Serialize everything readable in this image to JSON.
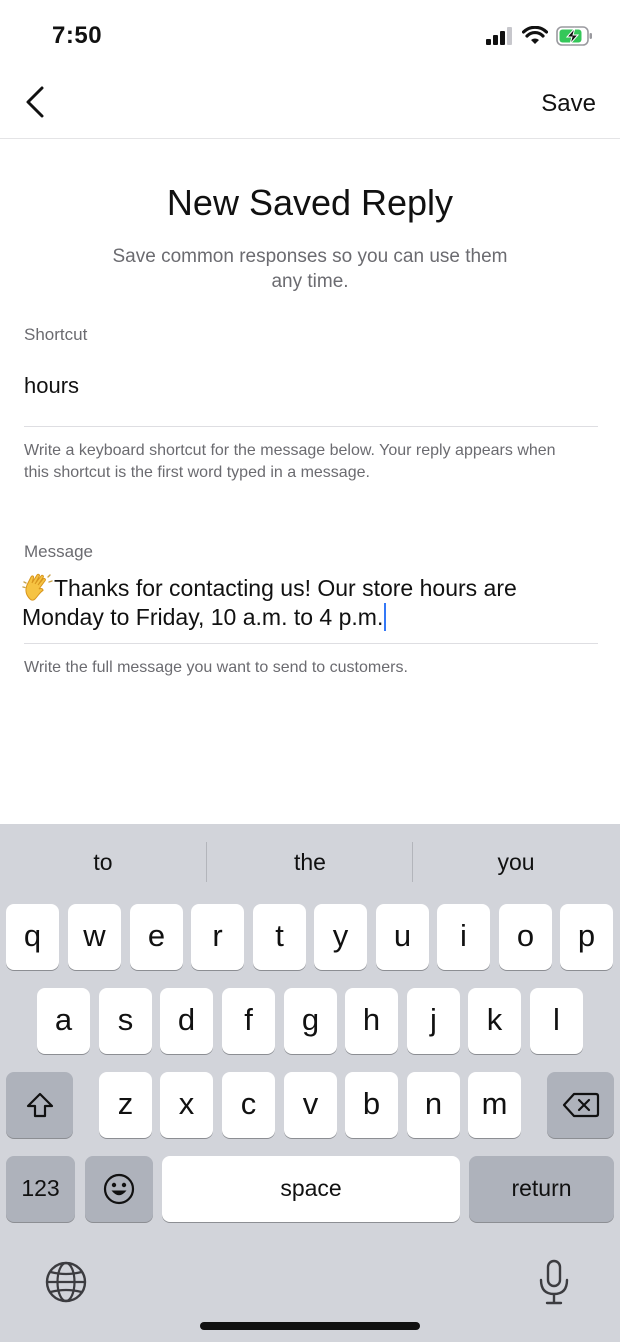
{
  "status_bar": {
    "time": "7:50",
    "icons": [
      "cellular-signal-icon",
      "wifi-icon",
      "battery-charging-icon"
    ]
  },
  "nav": {
    "back_icon": "chevron-left-icon",
    "save_label": "Save"
  },
  "form": {
    "title": "New Saved Reply",
    "subtitle": "Save common responses so you can use them any time.",
    "shortcut": {
      "label": "Shortcut",
      "value": "hours",
      "help": "Write a keyboard shortcut for the message below. Your reply appears when this shortcut is the first word typed in a message."
    },
    "message": {
      "label": "Message",
      "emoji_icon": "waving-hand-icon",
      "value_line1": "Thanks for contacting us! Our store hours are",
      "value_line2": "Monday to Friday, 10 a.m. to 4 p.m.",
      "help": "Write the full message you want to send to customers."
    }
  },
  "keyboard": {
    "suggestions": [
      "to",
      "the",
      "you"
    ],
    "row1": [
      "q",
      "w",
      "e",
      "r",
      "t",
      "y",
      "u",
      "i",
      "o",
      "p"
    ],
    "row2": [
      "a",
      "s",
      "d",
      "f",
      "g",
      "h",
      "j",
      "k",
      "l"
    ],
    "row3": [
      "z",
      "x",
      "c",
      "v",
      "b",
      "n",
      "m"
    ],
    "numbers_label": "123",
    "space_label": "space",
    "return_label": "return",
    "icons": {
      "shift": "shift-icon",
      "delete": "backspace-icon",
      "emoji": "emoji-icon",
      "globe": "globe-icon",
      "mic": "microphone-icon"
    }
  },
  "colors": {
    "caret": "#3478f6",
    "keyboard_bg": "#d2d4da",
    "dark_key": "#aeb2bb",
    "secondary_text": "#6b6b70"
  }
}
